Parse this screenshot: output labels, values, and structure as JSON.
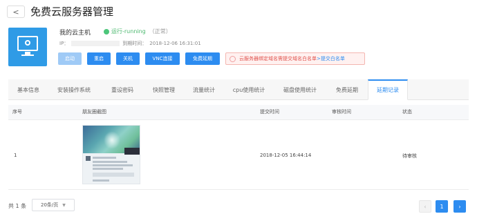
{
  "header": {
    "back_label": "<",
    "title": "免费云服务器管理"
  },
  "server": {
    "name": "我的云主机",
    "status_text": "运行-running",
    "status_note": "（正常）",
    "ip_label": "IP：",
    "expiry_label": "到期时间：",
    "expiry_value": "2018-12-06 16:31:01"
  },
  "actions": {
    "start": "启动",
    "restart": "重启",
    "shutdown": "关机",
    "vnc": "VNC连接",
    "extend": "免费延期"
  },
  "notice": {
    "text": "云服务器绑定域名需提交域名白名单",
    "link": ">提交白名单"
  },
  "tabs": [
    {
      "label": "基本信息"
    },
    {
      "label": "安装操作系统"
    },
    {
      "label": "重设密码"
    },
    {
      "label": "快照管理"
    },
    {
      "label": "流量统计"
    },
    {
      "label": "cpu使用统计"
    },
    {
      "label": "磁盘使用统计"
    },
    {
      "label": "免费延期"
    },
    {
      "label": "延期记录"
    }
  ],
  "table": {
    "headers": [
      "序号",
      "朋友圈截图",
      "提交时间",
      "审核时间",
      "状态"
    ],
    "rows": [
      {
        "index": "1",
        "submit_time": "2018-12-05 16:44:14",
        "review_time": "",
        "status": "待审核"
      }
    ]
  },
  "pagination": {
    "total": "共 1 条",
    "page_size": "20条/页",
    "prev": "‹",
    "current": "1",
    "next": "›"
  },
  "colors": {
    "primary": "#2d8cf0",
    "running": "#4cc67a",
    "notice_red": "#e0514b"
  }
}
